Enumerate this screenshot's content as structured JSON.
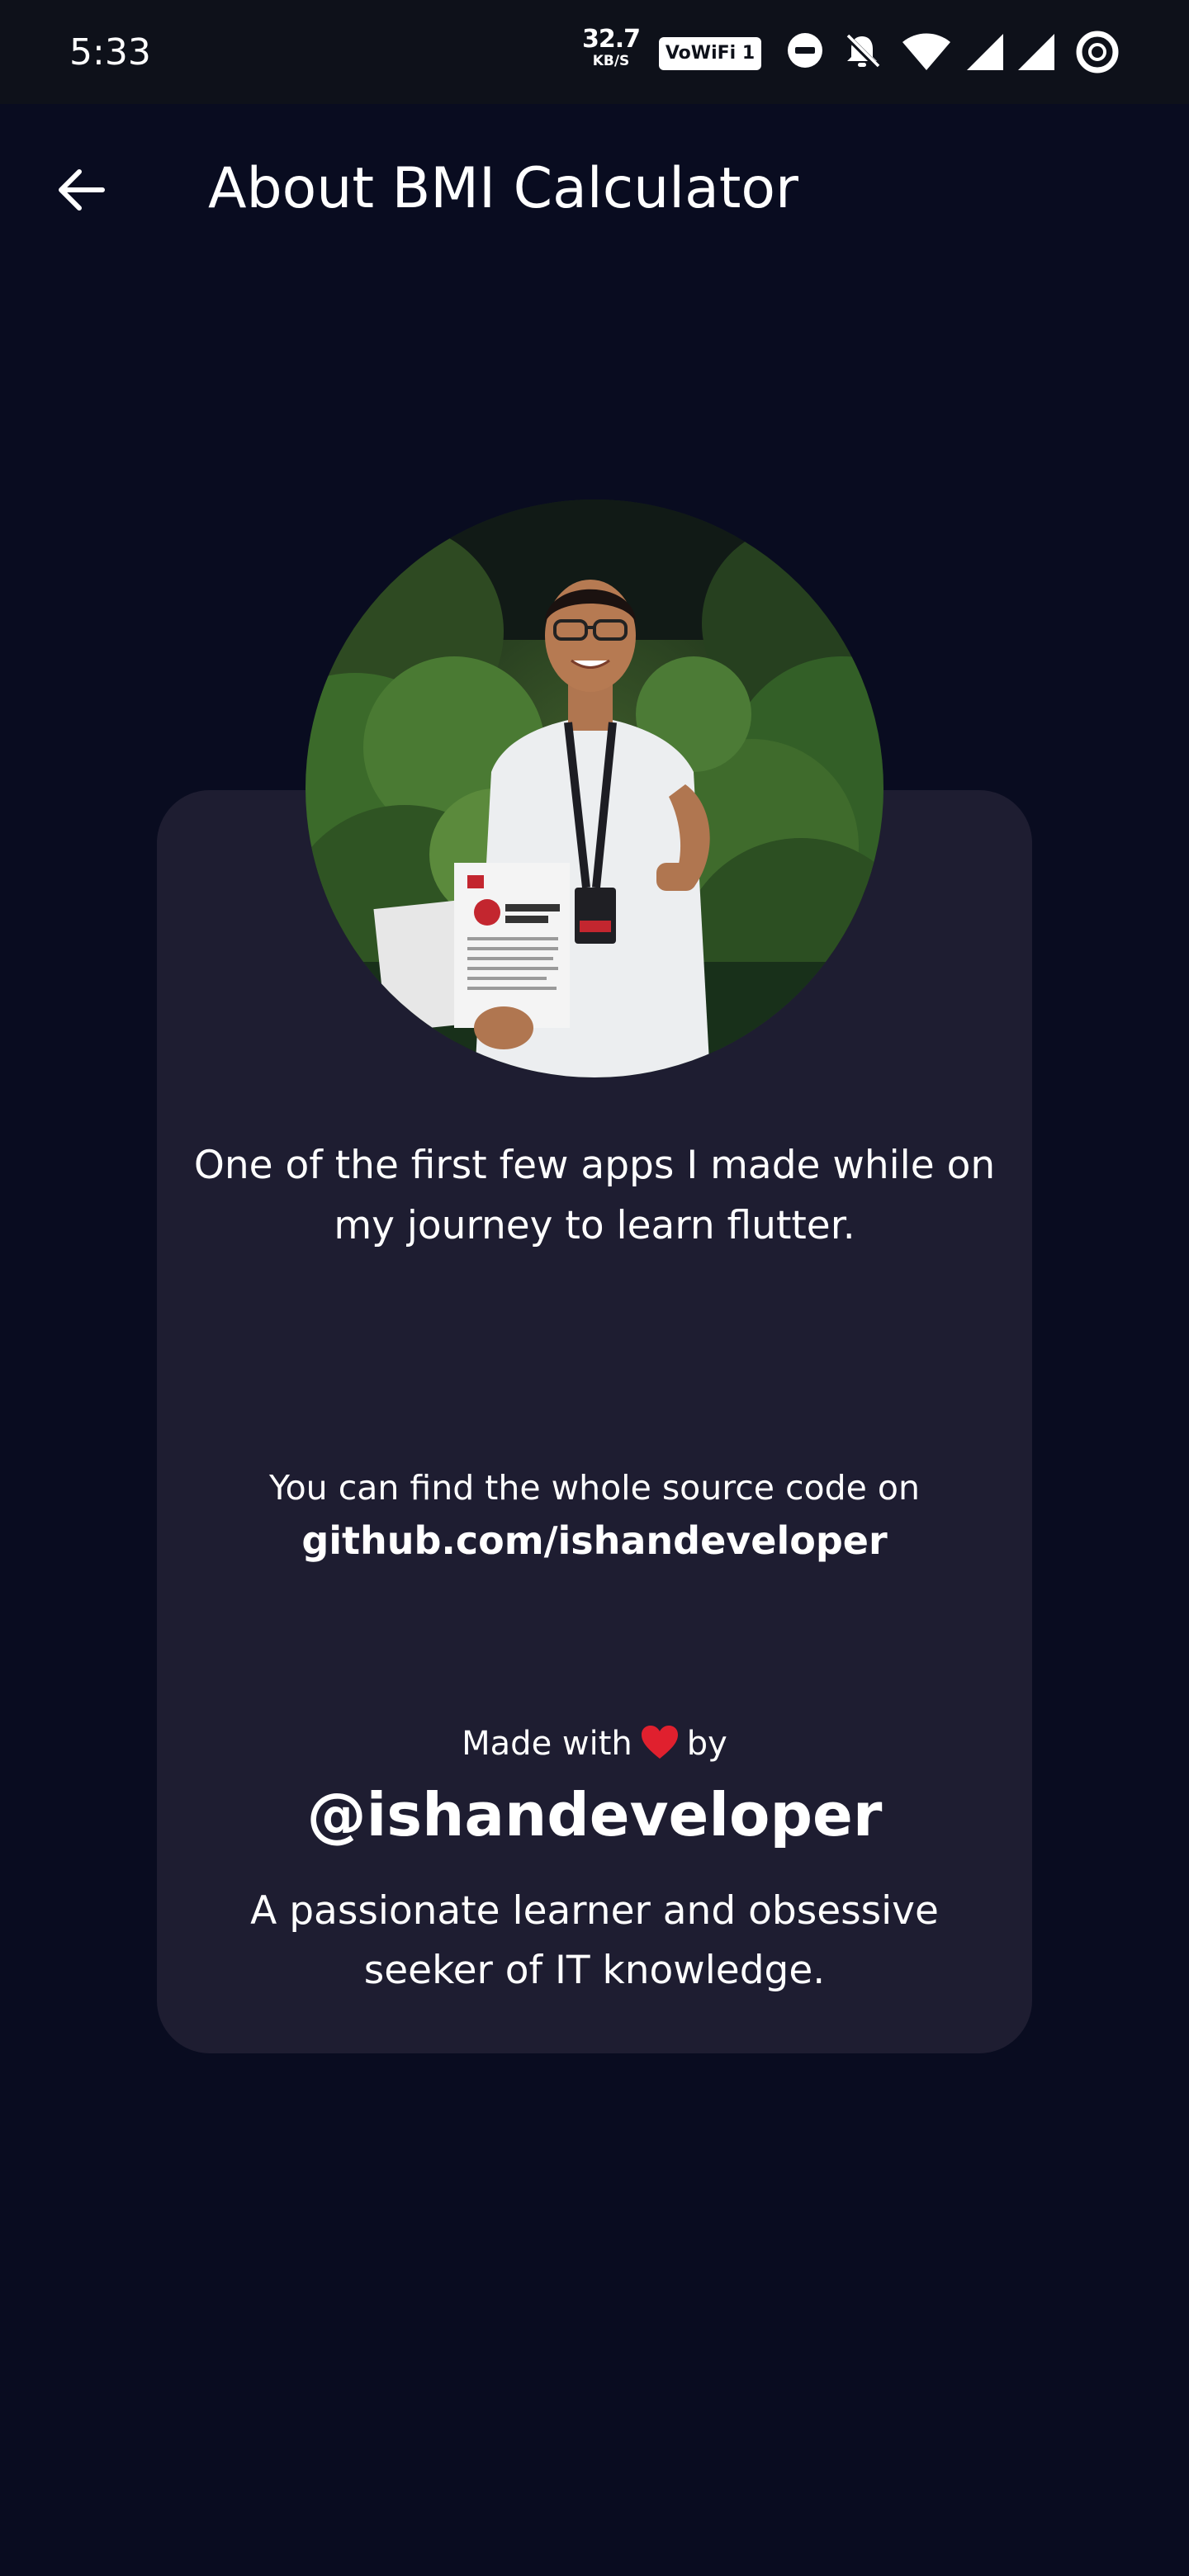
{
  "status_bar": {
    "time": "5:33",
    "network_speed_value": "32.7",
    "network_speed_unit": "KB/S",
    "wifi_badge": "VoWiFi 1",
    "icons": [
      "do-not-disturb-icon",
      "bell-muted-icon",
      "wifi-icon",
      "signal-icon",
      "signal-icon",
      "battery-ring-icon"
    ]
  },
  "app_bar": {
    "title": "About BMI Calculator",
    "back_icon": "arrow-left-icon"
  },
  "card": {
    "intro": "One of the first few apps I made while on my journey to learn flutter.",
    "source_label": "You can find the whole source code on",
    "source_link": "github.com/ishandeveloper",
    "made_with_prefix": "Made with",
    "made_with_suffix": "by",
    "heart_icon": "heart-icon",
    "handle": "@ishandeveloper",
    "bio": "A passionate learner and obsessive seeker of IT knowledge."
  },
  "colors": {
    "background": "#090c20",
    "status_bar": "#0e111a",
    "card": "#1e1d31",
    "text": "#ffffff",
    "heart": "#e0202e"
  }
}
